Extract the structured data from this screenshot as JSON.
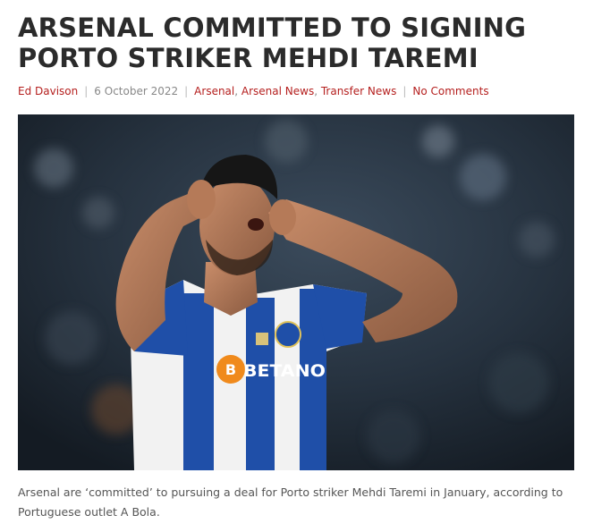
{
  "post": {
    "title_line1": "ARSENAL COMMITTED TO SIGNING",
    "title_line2": "PORTO STRIKER MEHDI TAREMI",
    "author": "Ed Davison",
    "date": "6 October 2022",
    "categories": [
      "Arsenal",
      "Arsenal News",
      "Transfer News"
    ],
    "comments": "No Comments",
    "separator": "|",
    "category_separator": ", "
  },
  "image": {
    "sponsor_text": "BETANO",
    "kit_colors": {
      "blue": "#1f4fa8",
      "white": "#f2f2f2"
    }
  },
  "excerpt": "Arsenal are ‘committed’ to pursuing a deal for Porto striker Mehdi Taremi in January, according to Portuguese outlet A Bola.",
  "colors": {
    "link": "#b5201f",
    "title": "#2b2b2b",
    "body_text": "#555555"
  }
}
